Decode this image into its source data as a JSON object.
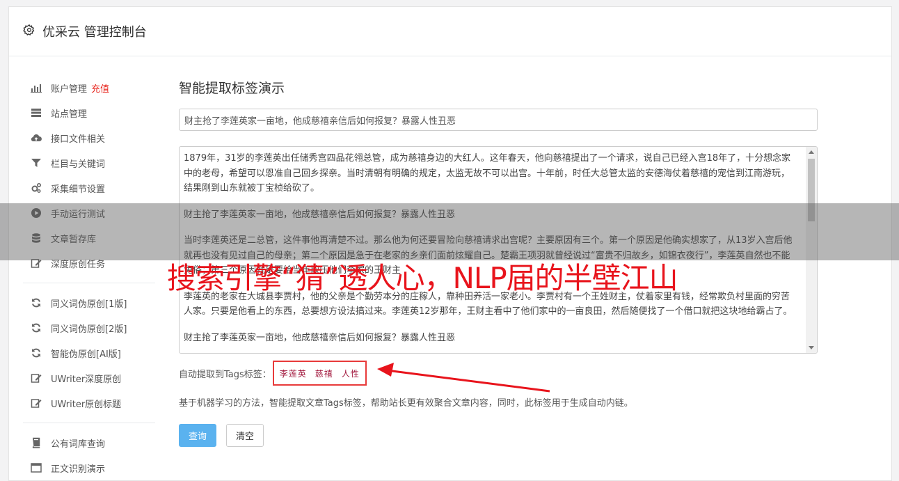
{
  "header": {
    "title": "优采云 管理控制台",
    "icon": "gear-icon"
  },
  "sidebar": {
    "group1": [
      {
        "label": "账户管理",
        "badge": "充值",
        "icon": "bar-chart-icon"
      },
      {
        "label": "站点管理",
        "icon": "server-icon"
      },
      {
        "label": "接口文件相关",
        "icon": "cloud-upload-icon"
      },
      {
        "label": "栏目与关键词",
        "icon": "filter-icon"
      },
      {
        "label": "采集细节设置",
        "icon": "cogs-icon"
      },
      {
        "label": "手动运行测试",
        "icon": "play-circle-icon"
      },
      {
        "label": "文章暂存库",
        "icon": "database-icon"
      },
      {
        "label": "深度原创任务",
        "icon": "edit-icon"
      }
    ],
    "group2": [
      {
        "label": "同义词伪原创[1版]",
        "icon": "refresh-icon"
      },
      {
        "label": "同义词伪原创[2版]",
        "icon": "refresh-icon"
      },
      {
        "label": "智能伪原创[AI版]",
        "icon": "refresh-icon"
      },
      {
        "label": "UWriter深度原创",
        "icon": "edit-icon"
      },
      {
        "label": "UWriter原创标题",
        "icon": "edit-icon"
      }
    ],
    "group3": [
      {
        "label": "公有词库查询",
        "icon": "book-icon"
      },
      {
        "label": "正文识别演示",
        "icon": "window-icon"
      }
    ]
  },
  "main": {
    "heading": "智能提取标签演示",
    "title_value": "财主抢了李莲英家一亩地，他成慈禧亲信后如何报复？暴露人性丑恶",
    "content_paragraphs": [
      "1879年，31岁的李莲英出任储秀宫四品花翎总管，成为慈禧身边的大红人。这年春天，他向慈禧提出了一个请求，说自己已经入宫18年了，十分想念家中的老母，希望可以恩准自己回乡探亲。当时清朝有明确的规定，太监无故不可以出宫。十年前，时任大总管太监的安德海仗着慈禧的宠信到江南游玩，结果刚到山东就被丁宝桢给砍了。",
      "财主抢了李莲英家一亩地，他成慈禧亲信后如何报复？暴露人性丑恶",
      "当时李莲英还是二总管，这件事他再清楚不过。那么他为何还要冒险向慈禧请求出宫呢？主要原因有三个。第一个原因是他确实想家了，从13岁入宫后他就再也没有见过自己的母亲；第二个原因是急于在老家的乡亲们面前炫耀自己。楚霸王项羽就曾经说过“富贵不归故乡，如锦衣夜行”，李莲英自然也不能免俗；第三个原因就是要给当年欺压他们李家的王财主",
      "李莲英的老家在大城县李贾村，他的父亲是个勤劳本分的庄稼人，靠种田养活一家老小。李贾村有一个王姓财主，仗着家里有钱，经常欺负村里面的穷苦人家。只要是他看上的东西，总要想方设法搞过来。李莲英12岁那年，王财主看中了他们家中的一亩良田，然后随便找了一个借口就把这块地给霸占了。",
      "财主抢了李莲英家一亩地，他成慈禧亲信后如何报复？暴露人性丑恶"
    ],
    "tags_label": "自动提取到Tags标签：",
    "tags": [
      "李莲英",
      "慈禧",
      "人性"
    ],
    "description": "基于机器学习的方法，智能提取文章Tags标签，帮助站长更有效聚合文章内容，同时，此标签用于生成自动内链。",
    "query_button": "查询",
    "clear_button": "清空"
  },
  "overlay": {
    "headline": "搜索引擎“猜”透人心，NLP届的半壁江山",
    "accent_color": "#e8141c"
  }
}
